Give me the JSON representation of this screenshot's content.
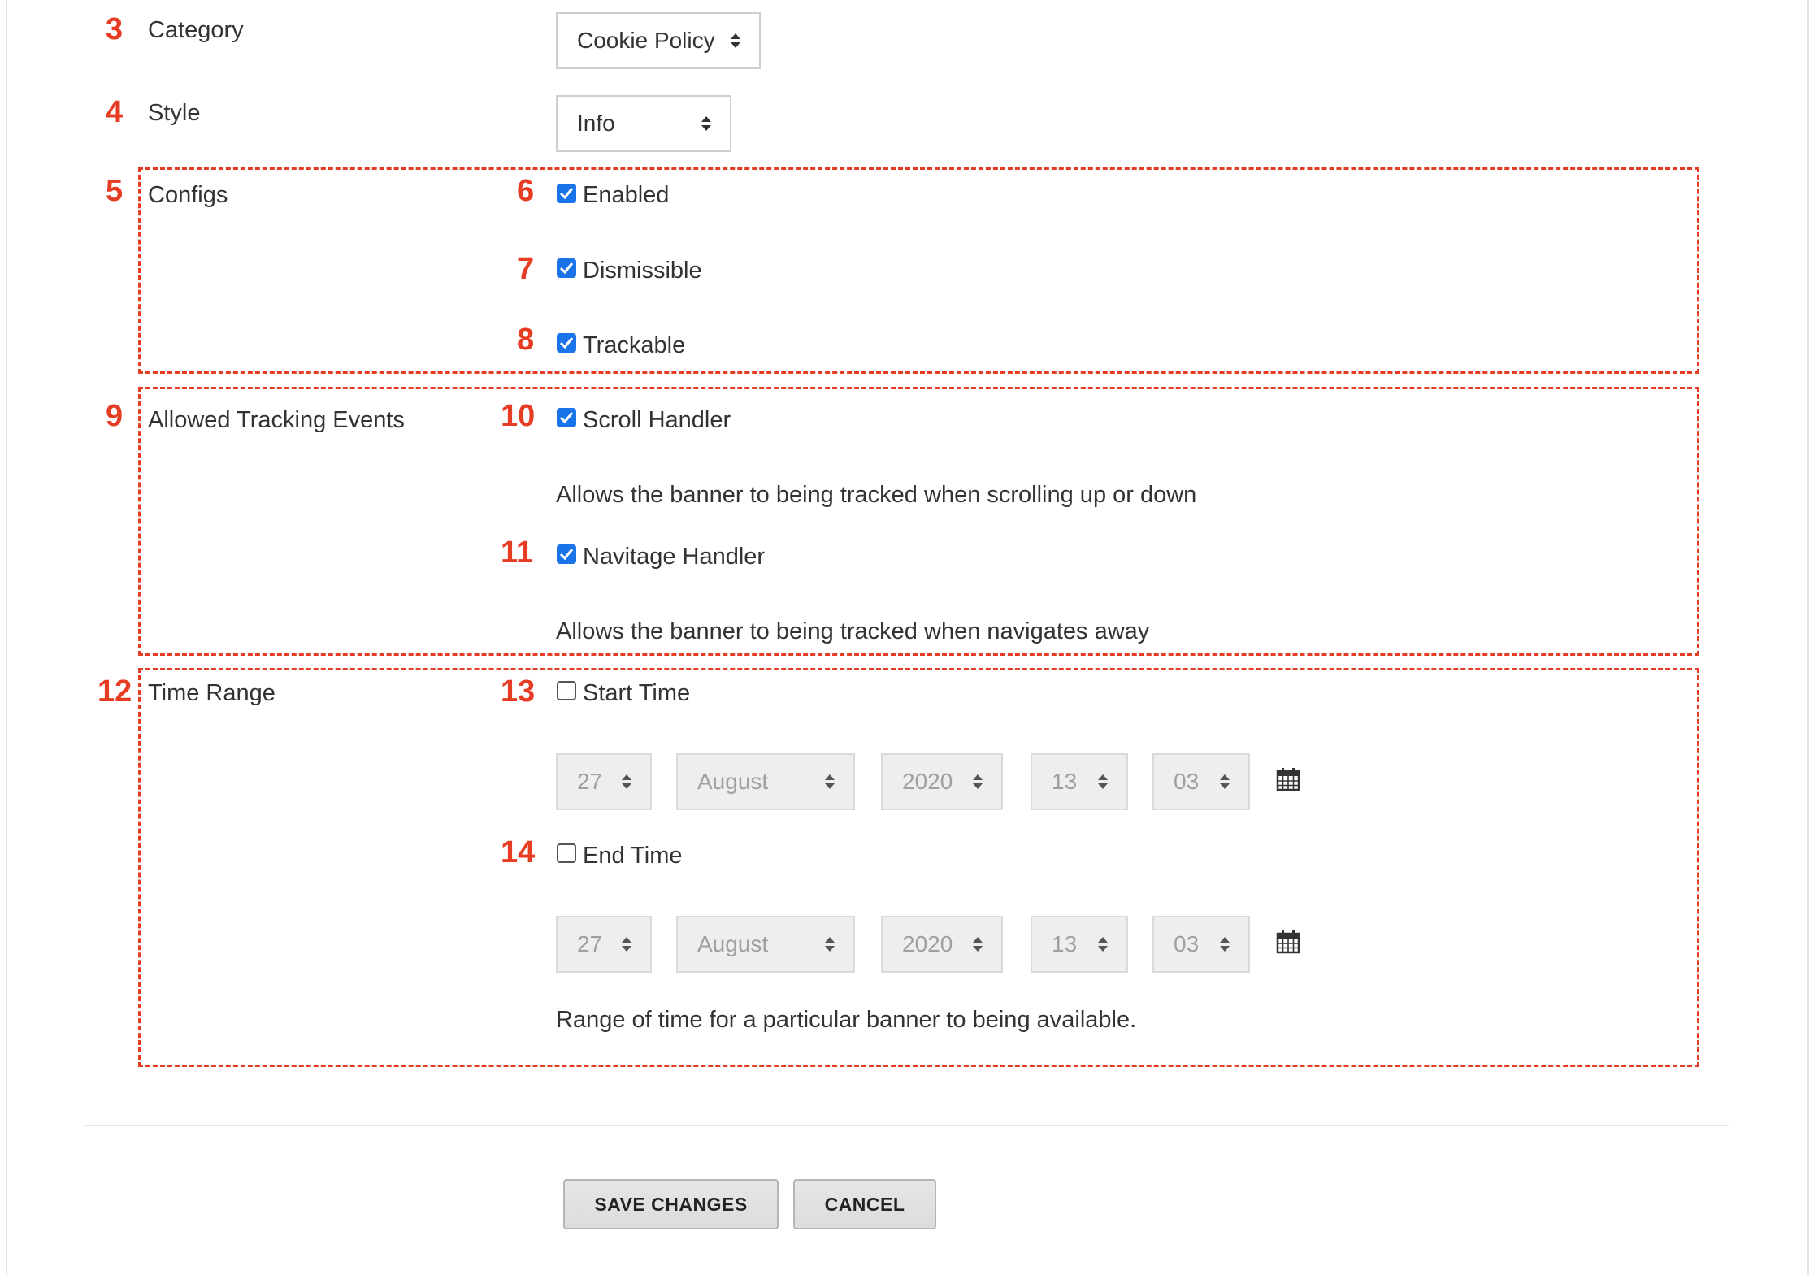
{
  "category": {
    "number": "3",
    "label": "Category",
    "value": "Cookie Policy"
  },
  "style": {
    "number": "4",
    "label": "Style",
    "value": "Info"
  },
  "configs": {
    "number": "5",
    "label": "Configs",
    "options": [
      {
        "number": "6",
        "label": "Enabled",
        "checked": true
      },
      {
        "number": "7",
        "label": "Dismissible",
        "checked": true
      },
      {
        "number": "8",
        "label": "Trackable",
        "checked": true
      }
    ]
  },
  "tracking": {
    "number": "9",
    "label": "Allowed Tracking Events",
    "options": [
      {
        "number": "10",
        "label": "Scroll Handler",
        "checked": true,
        "help": "Allows the banner to being tracked when scrolling up or down"
      },
      {
        "number": "11",
        "label": "Navitage Handler",
        "checked": true,
        "help": "Allows the banner to being tracked when navigates away"
      }
    ]
  },
  "time_range": {
    "number": "12",
    "label": "Time Range",
    "start": {
      "number": "13",
      "label": "Start Time",
      "checked": false,
      "day": "27",
      "month": "August",
      "year": "2020",
      "hour": "13",
      "minute": "03"
    },
    "end": {
      "number": "14",
      "label": "End Time",
      "checked": false,
      "day": "27",
      "month": "August",
      "year": "2020",
      "hour": "13",
      "minute": "03"
    },
    "help": "Range of time for a particular banner to being available."
  },
  "buttons": {
    "save": "SAVE CHANGES",
    "cancel": "CANCEL"
  },
  "colors": {
    "annotation": "#e63c24",
    "checkbox": "#1a73e8"
  },
  "icons": {
    "calendar": "calendar-icon",
    "select_arrows": "sort-arrows-icon"
  }
}
